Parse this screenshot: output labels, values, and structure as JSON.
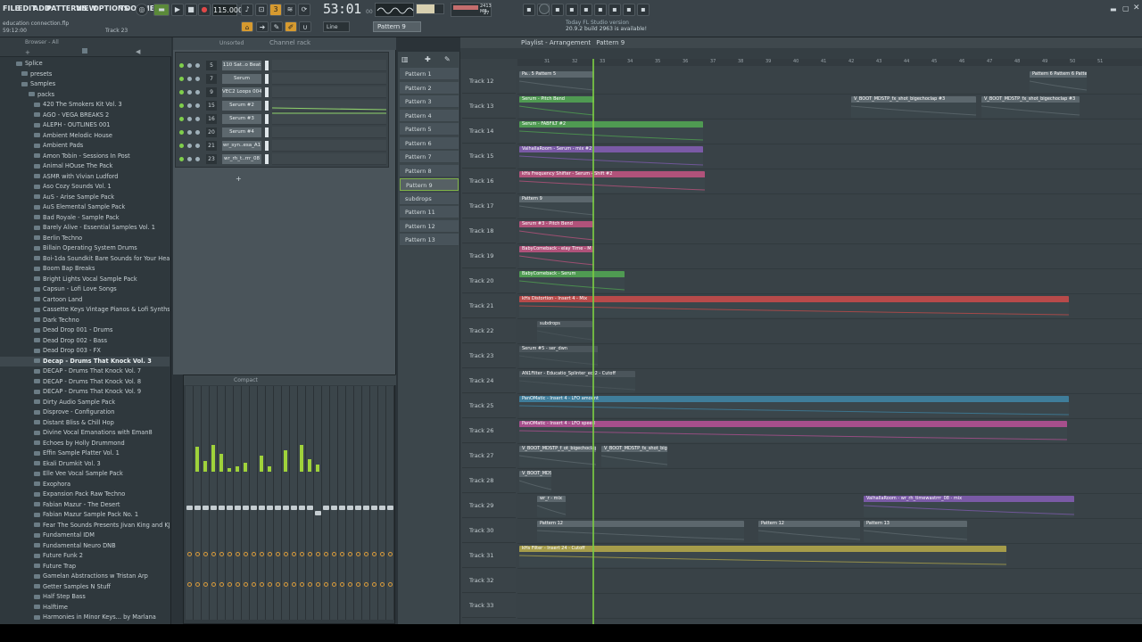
{
  "menu": [
    "FILE",
    "EDIT",
    "ADD",
    "PATTERNS",
    "VIEW",
    "OPTIONS",
    "TOOLS",
    "HELP"
  ],
  "hint": {
    "line1": "education connection.flp",
    "line2": "59:12:00",
    "line3": "Track 23"
  },
  "transport": {
    "tempo": "115.000",
    "time": "53:01",
    "time_sub": "00",
    "pattern": "Pattern 9",
    "snap": "Line"
  },
  "cpu": {
    "memory": "2413 MB",
    "voices": "27"
  },
  "news": {
    "line1": "Today  FL Studio version",
    "line2": "20.9.2 build 2963 is available!"
  },
  "browser": {
    "title": "Browser - All",
    "items": [
      {
        "label": "Splice",
        "type": "root"
      },
      {
        "label": "presets",
        "type": "folder"
      },
      {
        "label": "Samples",
        "type": "folder"
      },
      {
        "label": "packs",
        "type": "folder"
      },
      {
        "label": "420 The Smokers Kit Vol. 3"
      },
      {
        "label": "AGO - VEGA BREAKS 2"
      },
      {
        "label": "ALEPH - OUTLINES 001"
      },
      {
        "label": "Ambient Melodic House"
      },
      {
        "label": "Ambient Pads"
      },
      {
        "label": "Amon Tobin - Sessions In Post"
      },
      {
        "label": "Animal HOuse The Pack"
      },
      {
        "label": "ASMR with Vivian Ludford"
      },
      {
        "label": "Aso Cozy Sounds Vol. 1"
      },
      {
        "label": "AuS - Arise Sample Pack"
      },
      {
        "label": "AuS Elemental Sample Pack"
      },
      {
        "label": "Bad Royale - Sample Pack"
      },
      {
        "label": "Barely Alive - Essential Samples Vol. 1"
      },
      {
        "label": "Berlin Techno"
      },
      {
        "label": "Billain Operating System Drums"
      },
      {
        "label": "Boi-1da Soundkit Bare Sounds for Your Headtop"
      },
      {
        "label": "Boom Bap Breaks"
      },
      {
        "label": "Bright Lights Vocal Sample Pack"
      },
      {
        "label": "Capsun - Lofi Love Songs"
      },
      {
        "label": "Cartoon Land"
      },
      {
        "label": "Cassette Keys Vintage Pianos & Lofi Synths"
      },
      {
        "label": "Dark Techno"
      },
      {
        "label": "Dead Drop 001 - Drums"
      },
      {
        "label": "Dead Drop 002 - Bass"
      },
      {
        "label": "Dead Drop 003 - FX"
      },
      {
        "label": "Decap - Drums That Knock Vol. 3",
        "selected": true
      },
      {
        "label": "DECAP - Drums That Knock Vol. 7"
      },
      {
        "label": "DECAP - Drums That Knock Vol. 8"
      },
      {
        "label": "DECAP - Drums That Knock Vol. 9"
      },
      {
        "label": "Dirty Audio Sample Pack"
      },
      {
        "label": "Disprove - Configuration"
      },
      {
        "label": "Distant Bliss & Chill Hop"
      },
      {
        "label": "Divine Vocal Emanations with Eman8"
      },
      {
        "label": "Echoes by Holly Drummond"
      },
      {
        "label": "Effin Sample Platter Vol. 1"
      },
      {
        "label": "Ekali Drumkit Vol. 3"
      },
      {
        "label": "Elle Vee Vocal Sample Pack"
      },
      {
        "label": "Exophora"
      },
      {
        "label": "Expansion Pack Raw Techno"
      },
      {
        "label": "Fabian Mazur - The Desert"
      },
      {
        "label": "Fabian Mazur Sample Pack No. 1"
      },
      {
        "label": "Fear The Sounds Presents Jivan King and KJ Sawka"
      },
      {
        "label": "Fundamental IDM"
      },
      {
        "label": "Fundamental Neuro DNB"
      },
      {
        "label": "Future Funk 2"
      },
      {
        "label": "Future Trap"
      },
      {
        "label": "Gamelan Abstractions w Tristan Arp"
      },
      {
        "label": "Getter Samples N Stuff"
      },
      {
        "label": "Half Step Bass"
      },
      {
        "label": "Halftime"
      },
      {
        "label": "Harmonies in Minor Keys... by Marlana"
      }
    ]
  },
  "channel_rack": {
    "title": "Channel rack",
    "filter": "Unsorted",
    "channels": [
      {
        "num": "5",
        "name": "110 Sat..o Beat"
      },
      {
        "num": "7",
        "name": "Serum"
      },
      {
        "num": "9",
        "name": "VEC2 Loops 004"
      },
      {
        "num": "15",
        "name": "Serum #2"
      },
      {
        "num": "16",
        "name": "Serum #3"
      },
      {
        "num": "20",
        "name": "Serum #4"
      },
      {
        "num": "21",
        "name": "wr_syn..esa_A1"
      },
      {
        "num": "23",
        "name": "wr_rh_t..rrr_08"
      }
    ]
  },
  "mixer": {
    "title": "Compact"
  },
  "patterns": [
    "Pattern 1",
    "Pattern 2",
    "Pattern 3",
    "Pattern 4",
    "Pattern 5",
    "Pattern 6",
    "Pattern 7",
    "Pattern 8",
    "Pattern 9",
    "subdrops",
    "Pattern 11",
    "Pattern 12",
    "Pattern 13"
  ],
  "playlist": {
    "title": "Playlist - Arrangement",
    "pattern": "Pattern 9",
    "ruler": [
      "31",
      "32",
      "33",
      "34",
      "35",
      "36",
      "37",
      "38",
      "39",
      "40",
      "41",
      "42",
      "43",
      "44",
      "45",
      "46",
      "47",
      "48",
      "49",
      "50",
      "51"
    ],
    "tracks": [
      {
        "name": "Track 12",
        "clips": [
          {
            "label": "Pa.. 5   Pattern 5",
            "color": "#5c676d"
          },
          {
            "label": "Pattern 6  Pattern 6  Pattern 8",
            "color": "#5c676d"
          }
        ]
      },
      {
        "name": "Track 13",
        "clips": [
          {
            "label": "Serum - Pitch Bend",
            "color": "#4f9a52"
          },
          {
            "label": "V_BOOT_MDSTP_fx_shot_bigechoclap #3",
            "color": "#5c676d"
          },
          {
            "label": "V_BOOT_MDSTP_fx_shot_bigechoclap #3",
            "color": "#5c676d"
          }
        ]
      },
      {
        "name": "Track 14",
        "clips": [
          {
            "label": "Serum - FABFILT #2",
            "color": "#4f9a52"
          }
        ]
      },
      {
        "name": "Track 15",
        "clips": [
          {
            "label": "ValhallaRoom - Serum - mix #2",
            "color": "#7a5aa6"
          }
        ]
      },
      {
        "name": "Track 16",
        "clips": [
          {
            "label": "kHs Frequency Shifter - Serum - Shift #2",
            "color": "#b0527a"
          }
        ]
      },
      {
        "name": "Track 17",
        "clips": [
          {
            "label": "Pattern 9",
            "color": "#5c676d"
          }
        ]
      },
      {
        "name": "Track 18",
        "clips": [
          {
            "label": "Serum #3 - Pitch Bend",
            "color": "#b0527a"
          }
        ]
      },
      {
        "name": "Track 19",
        "clips": [
          {
            "label": "BabyComeback - elay Time - M",
            "color": "#b0527a"
          }
        ]
      },
      {
        "name": "Track 20",
        "clips": [
          {
            "label": "BabyComeback - Serum",
            "color": "#4f9a52"
          }
        ]
      },
      {
        "name": "Track 21",
        "clips": [
          {
            "label": "kHs Distortion - Insert 4 - Mix",
            "color": "#b84a4a"
          }
        ]
      },
      {
        "name": "Track 22",
        "clips": [
          {
            "label": "subdrops",
            "color": "#4b555b"
          }
        ]
      },
      {
        "name": "Track 23",
        "clips": [
          {
            "label": "Serum #5 - ser_dwn",
            "color": "#4b555b"
          }
        ]
      },
      {
        "name": "Track 24",
        "clips": [
          {
            "label": "AN1Filter - Educatio_Splinter_ect2 - Cutoff",
            "color": "#4b555b"
          }
        ]
      },
      {
        "name": "Track 25",
        "clips": [
          {
            "label": "PanOMatic - Insert 4 - LFO amount",
            "color": "#3f7d9a"
          }
        ]
      },
      {
        "name": "Track 26",
        "clips": [
          {
            "label": "PanOMatic - Insert 4 - LFO speed",
            "color": "#a64f8c"
          }
        ]
      },
      {
        "name": "Track 27",
        "clips": [
          {
            "label": "V_BOOT_MDSTP_f_ot_bigechoclap",
            "color": "#5c676d"
          },
          {
            "label": "V_BOOT_MDSTP_fx_shot_bigechoclap #3",
            "color": "#5c676d"
          }
        ]
      },
      {
        "name": "Track 28",
        "clips": [
          {
            "label": "V_BOOT_MDSTP_fx_Rhsr_with_clap",
            "color": "#5c676d"
          }
        ]
      },
      {
        "name": "Track 29",
        "clips": [
          {
            "label": "wr_r - mix",
            "color": "#5c676d"
          },
          {
            "label": "ValhallaRoom - wr_rh_timewastrrr_08 - mix",
            "color": "#7a5aa6"
          }
        ]
      },
      {
        "name": "Track 30",
        "clips": [
          {
            "label": "Pattern 12",
            "color": "#5c676d"
          },
          {
            "label": "Pattern 12",
            "color": "#5c676d"
          },
          {
            "label": "Pattern 13",
            "color": "#5c676d"
          }
        ]
      },
      {
        "name": "Track 31",
        "clips": [
          {
            "label": "kHs Filter - Insert 24 - Cutoff",
            "color": "#a59c4a"
          }
        ]
      },
      {
        "name": "Track 32",
        "clips": []
      },
      {
        "name": "Track 33",
        "clips": []
      }
    ]
  }
}
